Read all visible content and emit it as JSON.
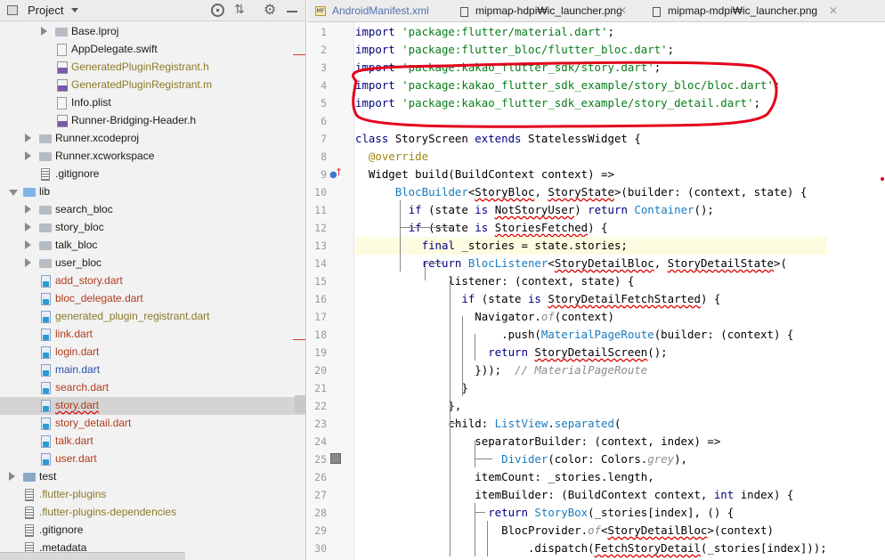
{
  "project_panel": {
    "title": "Project",
    "tree": [
      {
        "label": "Base.lproj",
        "kind": "folder",
        "depth": 3,
        "arrow": "closed",
        "color": "normal"
      },
      {
        "label": "AppDelegate.swift",
        "kind": "swift",
        "depth": 3,
        "arrow": "none",
        "color": "normal"
      },
      {
        "label": "GeneratedPluginRegistrant.h",
        "kind": "cpp",
        "depth": 3,
        "arrow": "none",
        "color": "olive"
      },
      {
        "label": "GeneratedPluginRegistrant.m",
        "kind": "cpp",
        "depth": 3,
        "arrow": "none",
        "color": "olive"
      },
      {
        "label": "Info.plist",
        "kind": "plist",
        "depth": 3,
        "arrow": "none",
        "color": "normal"
      },
      {
        "label": "Runner-Bridging-Header.h",
        "kind": "cpp",
        "depth": 3,
        "arrow": "none",
        "color": "normal"
      },
      {
        "label": "Runner.xcodeproj",
        "kind": "folder",
        "depth": 2,
        "arrow": "closed",
        "color": "normal"
      },
      {
        "label": "Runner.xcworkspace",
        "kind": "folder",
        "depth": 2,
        "arrow": "closed",
        "color": "normal"
      },
      {
        "label": ".gitignore",
        "kind": "file",
        "depth": 2,
        "arrow": "none",
        "color": "normal"
      },
      {
        "label": "lib",
        "kind": "folder-blue",
        "depth": 1,
        "arrow": "open",
        "color": "normal"
      },
      {
        "label": "search_bloc",
        "kind": "folder",
        "depth": 2,
        "arrow": "closed",
        "color": "normal"
      },
      {
        "label": "story_bloc",
        "kind": "folder",
        "depth": 2,
        "arrow": "closed",
        "color": "normal"
      },
      {
        "label": "talk_bloc",
        "kind": "folder",
        "depth": 2,
        "arrow": "closed",
        "color": "normal"
      },
      {
        "label": "user_bloc",
        "kind": "folder",
        "depth": 2,
        "arrow": "closed",
        "color": "normal"
      },
      {
        "label": "add_story.dart",
        "kind": "dart",
        "depth": 2,
        "arrow": "none",
        "color": "red"
      },
      {
        "label": "bloc_delegate.dart",
        "kind": "dart",
        "depth": 2,
        "arrow": "none",
        "color": "red"
      },
      {
        "label": "generated_plugin_registrant.dart",
        "kind": "dart",
        "depth": 2,
        "arrow": "none",
        "color": "olive"
      },
      {
        "label": "link.dart",
        "kind": "dart",
        "depth": 2,
        "arrow": "none",
        "color": "red"
      },
      {
        "label": "login.dart",
        "kind": "dart",
        "depth": 2,
        "arrow": "none",
        "color": "red"
      },
      {
        "label": "main.dart",
        "kind": "dart",
        "depth": 2,
        "arrow": "none",
        "color": "blue"
      },
      {
        "label": "search.dart",
        "kind": "dart",
        "depth": 2,
        "arrow": "none",
        "color": "red"
      },
      {
        "label": "story.dart",
        "kind": "dart",
        "depth": 2,
        "arrow": "none",
        "color": "red-underline",
        "selected": true
      },
      {
        "label": "story_detail.dart",
        "kind": "dart",
        "depth": 2,
        "arrow": "none",
        "color": "red"
      },
      {
        "label": "talk.dart",
        "kind": "dart",
        "depth": 2,
        "arrow": "none",
        "color": "red"
      },
      {
        "label": "user.dart",
        "kind": "dart",
        "depth": 2,
        "arrow": "none",
        "color": "red"
      },
      {
        "label": "test",
        "kind": "folder-green",
        "depth": 1,
        "arrow": "closed",
        "color": "normal"
      },
      {
        "label": ".flutter-plugins",
        "kind": "file",
        "depth": 1,
        "arrow": "none",
        "color": "olive"
      },
      {
        "label": ".flutter-plugins-dependencies",
        "kind": "file",
        "depth": 1,
        "arrow": "none",
        "color": "olive"
      },
      {
        "label": ".gitignore",
        "kind": "file",
        "depth": 1,
        "arrow": "none",
        "color": "normal"
      },
      {
        "label": ".metadata",
        "kind": "file",
        "depth": 1,
        "arrow": "none",
        "color": "normal"
      }
    ]
  },
  "tabs": [
    {
      "label": "AndroidManifest.xml",
      "badge": "MF"
    },
    {
      "label": "mipmap-hdpi₩ic_launcher.png",
      "badge": ""
    },
    {
      "label": "mipmap-mdpi₩ic_launcher.png",
      "badge": ""
    }
  ],
  "editor": {
    "highlight_color": "#e3001b",
    "lines": [
      {
        "n": "1",
        "code": [
          [
            "k",
            "import "
          ],
          [
            "s",
            "'package:flutter/material.dart'"
          ],
          [
            "",
            "; "
          ]
        ]
      },
      {
        "n": "2",
        "code": [
          [
            "k",
            "import "
          ],
          [
            "s",
            "'package:flutter_bloc/flutter_bloc.dart'"
          ],
          [
            "",
            ";"
          ]
        ]
      },
      {
        "n": "3",
        "code": [
          [
            "k",
            "import "
          ],
          [
            "s",
            "'package:kakao_flutter_sdk/story.dart'"
          ],
          [
            "",
            ";"
          ]
        ]
      },
      {
        "n": "4",
        "code": [
          [
            "k",
            "import "
          ],
          [
            "s",
            "'package:kakao_flutter_sdk_example/story_bloc/bloc.dart'"
          ],
          [
            "",
            ";"
          ]
        ]
      },
      {
        "n": "5",
        "code": [
          [
            "k",
            "import "
          ],
          [
            "s",
            "'package:kakao_flutter_sdk_example/story_detail.dart'"
          ],
          [
            "",
            ";"
          ]
        ]
      },
      {
        "n": "6",
        "code": []
      },
      {
        "n": "7",
        "code": [
          [
            "k",
            "class "
          ],
          [
            "",
            "StoryScreen "
          ],
          [
            "k",
            "extends "
          ],
          [
            "",
            "StatelessWidget {"
          ]
        ]
      },
      {
        "n": "8",
        "code": [
          [
            "",
            "  "
          ],
          [
            "a",
            "@override"
          ]
        ]
      },
      {
        "n": "9",
        "code": [
          [
            "",
            "  Widget build(BuildContext context) =>"
          ]
        ]
      },
      {
        "n": "10",
        "code": [
          [
            "",
            "      "
          ],
          [
            "t",
            "BlocBuilder"
          ],
          [
            "",
            "<"
          ],
          [
            "r",
            "StoryBloc"
          ],
          [
            "",
            ", "
          ],
          [
            "r",
            "StoryState"
          ],
          [
            "",
            ">(builder: (context, state) {"
          ]
        ]
      },
      {
        "n": "11",
        "code": [
          [
            "",
            "        "
          ],
          [
            "k",
            "if "
          ],
          [
            "",
            "(state "
          ],
          [
            "k",
            "is "
          ],
          [
            "r",
            "NotStoryUser"
          ],
          [
            "",
            ") "
          ],
          [
            "k",
            "return "
          ],
          [
            "t",
            "Container"
          ],
          [
            "",
            "();"
          ]
        ]
      },
      {
        "n": "12",
        "code": [
          [
            "",
            "        "
          ],
          [
            "k",
            "if "
          ],
          [
            "",
            "(state "
          ],
          [
            "k",
            "is "
          ],
          [
            "r",
            "StoriesFetched"
          ],
          [
            "",
            ") {"
          ]
        ]
      },
      {
        "n": "13",
        "code": [
          [
            "",
            "          "
          ],
          [
            "k",
            "final "
          ],
          [
            "",
            "_stories = state.stories;"
          ]
        ]
      },
      {
        "n": "14",
        "code": [
          [
            "",
            "          "
          ],
          [
            "k",
            "return "
          ],
          [
            "t",
            "BlocListener"
          ],
          [
            "",
            "<"
          ],
          [
            "r",
            "StoryDetailBloc"
          ],
          [
            "",
            ", "
          ],
          [
            "r",
            "StoryDetailState"
          ],
          [
            "",
            ">("
          ]
        ]
      },
      {
        "n": "15",
        "code": [
          [
            "",
            "              listener: (context, state) {"
          ]
        ]
      },
      {
        "n": "16",
        "code": [
          [
            "",
            "                "
          ],
          [
            "k",
            "if "
          ],
          [
            "",
            "(state "
          ],
          [
            "k",
            "is "
          ],
          [
            "r",
            "StoryDetailFetchStarted"
          ],
          [
            "",
            ") {"
          ]
        ]
      },
      {
        "n": "17",
        "code": [
          [
            "",
            "                  Navigator."
          ],
          [
            "c",
            "of"
          ],
          [
            "",
            "(context)"
          ]
        ]
      },
      {
        "n": "18",
        "code": [
          [
            "",
            "                      .push("
          ],
          [
            "t",
            "MaterialPageRoute"
          ],
          [
            "",
            "(builder: (context) {"
          ]
        ]
      },
      {
        "n": "19",
        "code": [
          [
            "",
            "                    "
          ],
          [
            "k",
            "return "
          ],
          [
            "r",
            "StoryDetailScreen"
          ],
          [
            "",
            "();"
          ]
        ]
      },
      {
        "n": "20",
        "code": [
          [
            "",
            "                  }));  "
          ],
          [
            "c",
            "// MaterialPageRoute"
          ]
        ]
      },
      {
        "n": "21",
        "code": [
          [
            "",
            "                }"
          ]
        ]
      },
      {
        "n": "22",
        "code": [
          [
            "",
            "              },"
          ]
        ]
      },
      {
        "n": "23",
        "code": [
          [
            "",
            "              child: "
          ],
          [
            "t",
            "ListView"
          ],
          [
            "",
            "."
          ],
          [
            "t",
            "separated"
          ],
          [
            "",
            "("
          ]
        ]
      },
      {
        "n": "24",
        "code": [
          [
            "",
            "                  separatorBuilder: (context, index) =>"
          ]
        ]
      },
      {
        "n": "25",
        "code": [
          [
            "",
            "                      "
          ],
          [
            "t",
            "Divider"
          ],
          [
            "",
            "(color: Colors."
          ],
          [
            "c",
            "grey"
          ],
          [
            "",
            "),"
          ]
        ]
      },
      {
        "n": "26",
        "code": [
          [
            "",
            "                  itemCount: _stories.length,"
          ]
        ]
      },
      {
        "n": "27",
        "code": [
          [
            "",
            "                  itemBuilder: (BuildContext context, "
          ],
          [
            "k",
            "int "
          ],
          [
            "",
            "index) {"
          ]
        ]
      },
      {
        "n": "28",
        "code": [
          [
            "",
            "                    "
          ],
          [
            "k",
            "return "
          ],
          [
            "t",
            "StoryBox"
          ],
          [
            "",
            "(_stories[index], () {"
          ]
        ]
      },
      {
        "n": "29",
        "code": [
          [
            "",
            "                      BlocProvider."
          ],
          [
            "c",
            "of"
          ],
          [
            "",
            "<"
          ],
          [
            "r",
            "StoryDetailBloc"
          ],
          [
            "",
            ">(context)"
          ]
        ]
      },
      {
        "n": "30",
        "code": [
          [
            "",
            "                          .dispatch("
          ],
          [
            "r",
            "FetchStoryDetail"
          ],
          [
            "",
            "(_stories[index]));"
          ]
        ]
      }
    ]
  }
}
